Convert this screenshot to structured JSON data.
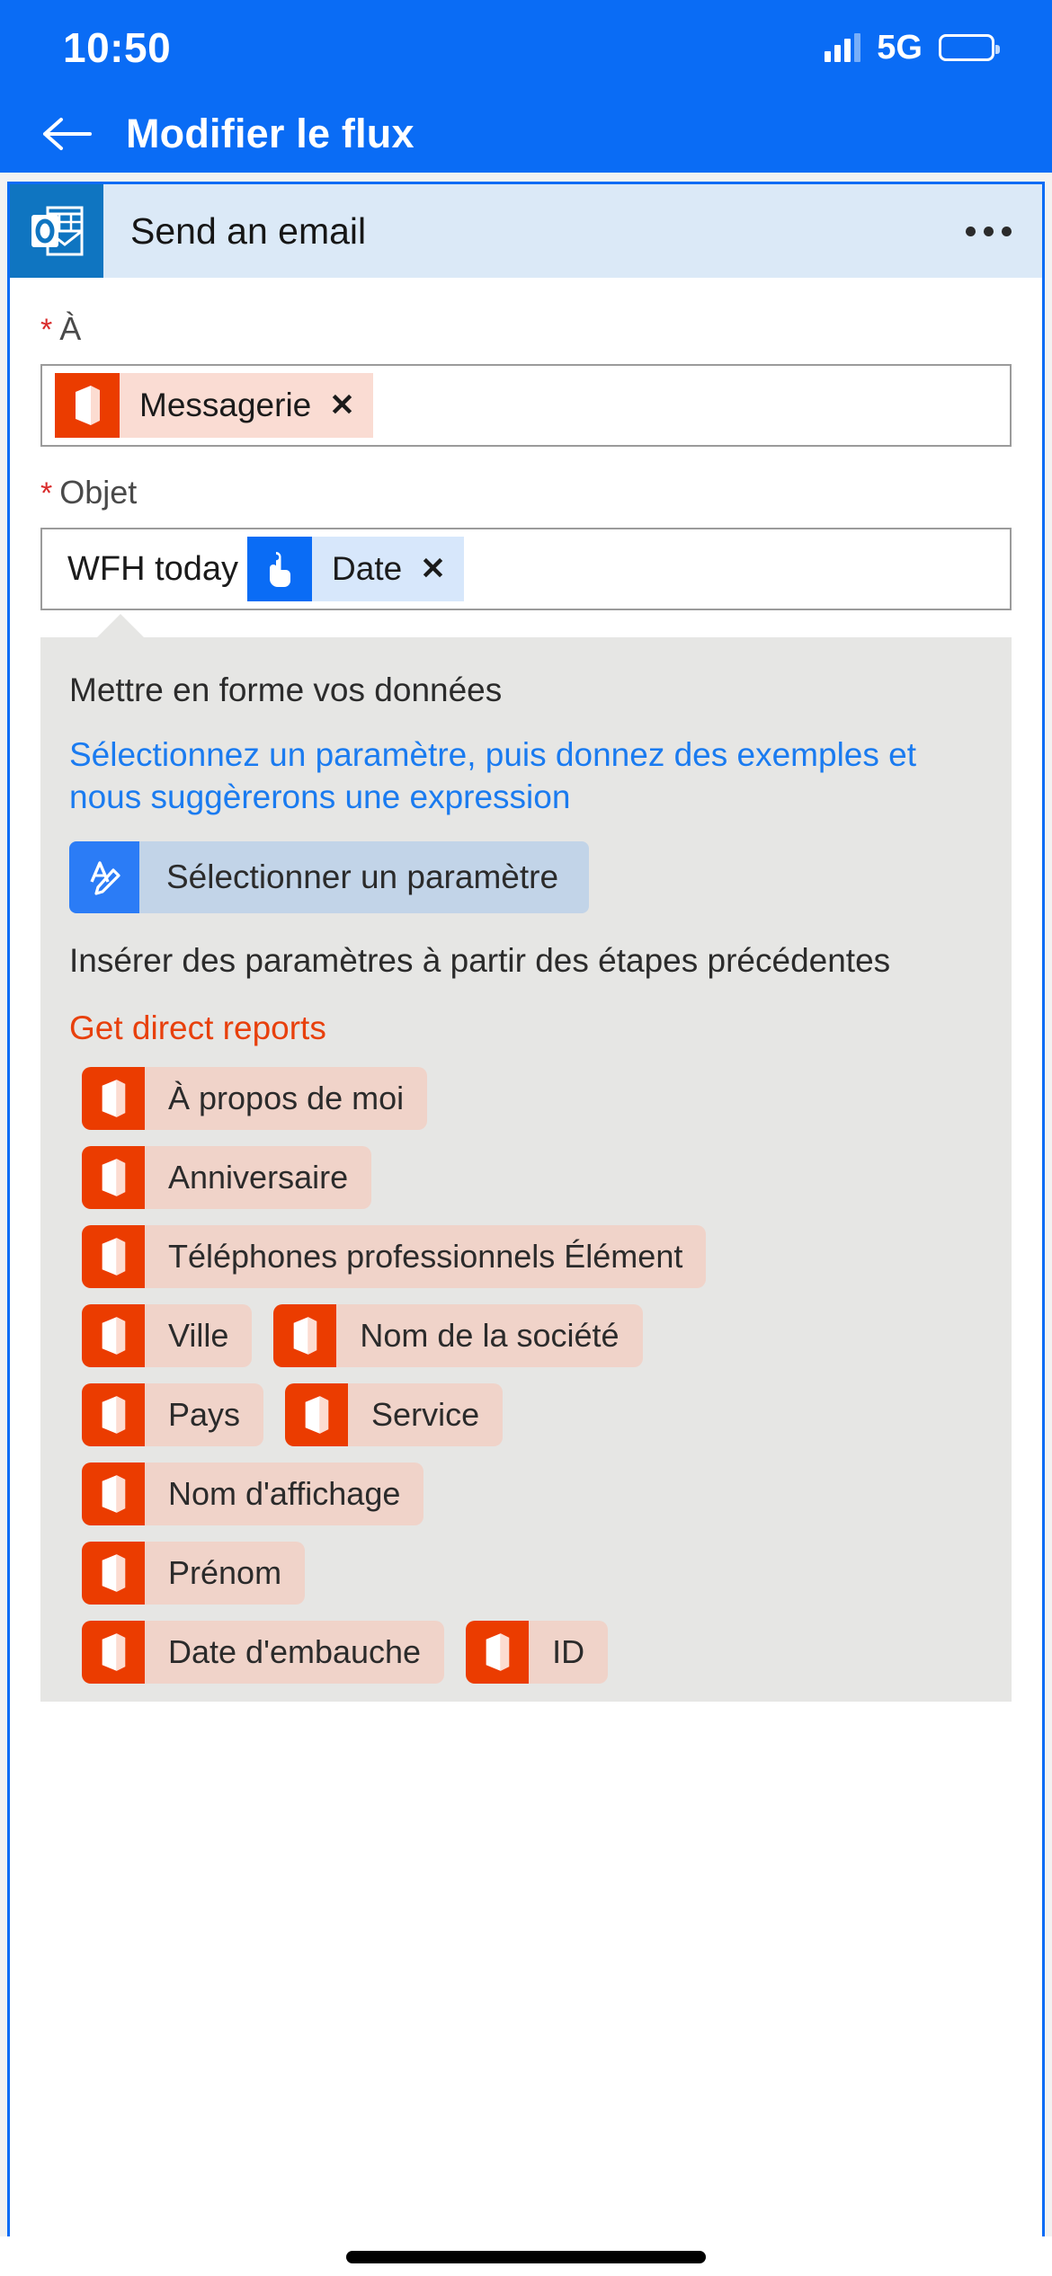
{
  "status_bar": {
    "time": "10:50",
    "network": "5G",
    "battery_icon": "battery-icon",
    "signal_icon": "cellular-signal-icon"
  },
  "app_bar": {
    "back_icon": "back-arrow-icon",
    "title": "Modifier le flux"
  },
  "action_card": {
    "connector_icon": "outlook-icon",
    "title": "Send an email",
    "more_icon": "more-options-icon"
  },
  "fields": {
    "to": {
      "required_marker": "*",
      "label": "À",
      "token": {
        "icon": "office365-icon",
        "label": "Messagerie",
        "remove": "✕"
      }
    },
    "subject": {
      "required_marker": "*",
      "label": "Objet",
      "typed_value": "WFH today",
      "token": {
        "icon": "manual-trigger-icon",
        "label": "Date",
        "remove": "✕"
      }
    }
  },
  "flyout": {
    "format_title": "Mettre en forme vos données",
    "format_hint": "Sélectionnez un paramètre, puis donnez des exemples et nous suggèrerons une expression",
    "select_param_button": {
      "icon": "format-expression-icon",
      "label": "Sélectionner un paramètre"
    },
    "insert_title": "Insérer des paramètres à partir des étapes précédentes",
    "group_name": "Get direct reports",
    "chip_rows": [
      [
        {
          "icon": "office365-icon",
          "label": "À propos de moi"
        }
      ],
      [
        {
          "icon": "office365-icon",
          "label": "Anniversaire"
        }
      ],
      [
        {
          "icon": "office365-icon",
          "label": "Téléphones professionnels Élément"
        }
      ],
      [
        {
          "icon": "office365-icon",
          "label": "Ville"
        },
        {
          "icon": "office365-icon",
          "label": "Nom de la société"
        }
      ],
      [
        {
          "icon": "office365-icon",
          "label": "Pays"
        },
        {
          "icon": "office365-icon",
          "label": "Service"
        }
      ],
      [
        {
          "icon": "office365-icon",
          "label": "Nom d'affichage"
        }
      ],
      [
        {
          "icon": "office365-icon",
          "label": "Prénom"
        }
      ],
      [
        {
          "icon": "office365-icon",
          "label": "Date d'embauche"
        },
        {
          "icon": "office365-icon",
          "label": "ID"
        }
      ]
    ]
  },
  "colors": {
    "brand_blue": "#0A6CF5",
    "outlook_blue": "#0F75C1",
    "card_header_bg": "#dbe9f7",
    "office_orange": "#EB3C00",
    "chip_bg": "#f0d3c9",
    "flyout_bg": "#e6e6e4",
    "link_blue": "#1a7bf0",
    "group_orange": "#E8400C",
    "required_red": "#d92b2b"
  }
}
